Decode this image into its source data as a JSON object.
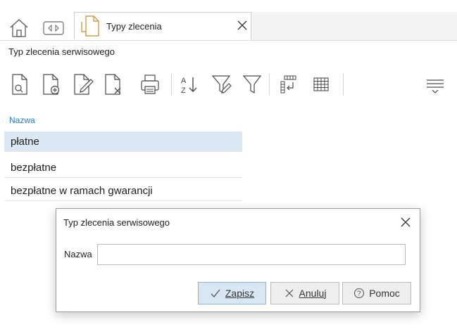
{
  "tabbar": {
    "home_icon": "home-icon",
    "nav_icon": "tab-navigation-icon",
    "tab": {
      "label": "Typy zlecenia",
      "icon": "document-icon",
      "close_icon": "close-icon"
    }
  },
  "section": {
    "title": "Typ zlecenia serwisowego"
  },
  "toolbar": {
    "buttons": [
      {
        "icon": "view-document-icon"
      },
      {
        "icon": "add-document-icon"
      },
      {
        "icon": "edit-document-icon"
      },
      {
        "icon": "delete-document-icon"
      },
      {
        "icon": "print-icon"
      },
      {
        "icon": "sort-az-icon"
      },
      {
        "icon": "filter-edit-icon"
      },
      {
        "icon": "filter-icon"
      },
      {
        "icon": "column-layout-icon"
      },
      {
        "icon": "grid-icon"
      },
      {
        "icon": "more-options-icon"
      }
    ]
  },
  "list": {
    "header": "Nazwa",
    "rows": [
      {
        "label": "płatne",
        "selected": true
      },
      {
        "label": "bezpłatne",
        "selected": false
      },
      {
        "label": "bezpłatne w ramach gwarancji",
        "selected": false
      }
    ]
  },
  "dialog": {
    "title": "Typ zlecenia serwisowego",
    "field_label": "Nazwa",
    "field_value": "",
    "buttons": {
      "save": {
        "label": "Zapisz",
        "icon": "checkmark-icon"
      },
      "cancel": {
        "label": "Anuluj",
        "icon": "close-icon"
      },
      "help": {
        "label": "Pomoc",
        "icon": "help-icon"
      }
    }
  },
  "colors": {
    "accent": "#1a7bd0",
    "selection": "#dbe8f3",
    "primary_button": "#d9e7f5"
  }
}
